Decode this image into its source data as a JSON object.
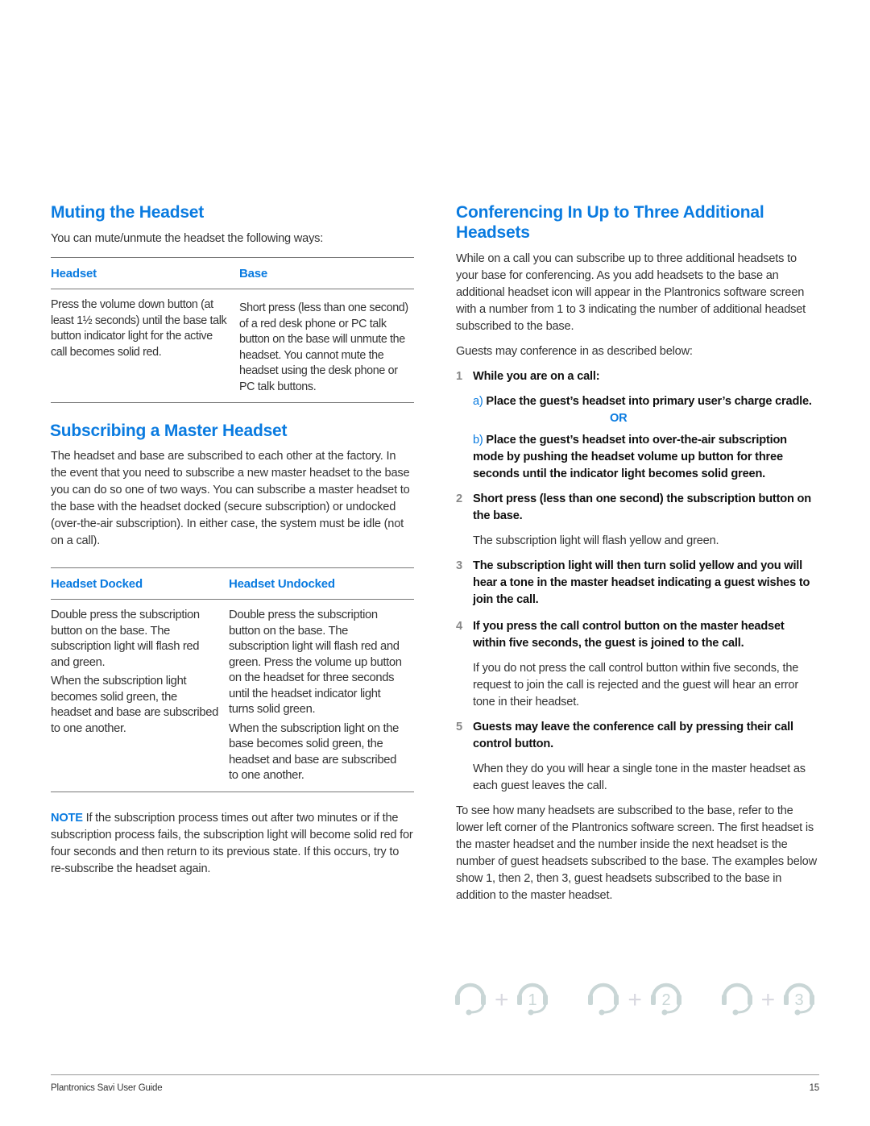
{
  "muting": {
    "title": "Muting the Headset",
    "intro": "You can mute/unmute the headset the following ways:",
    "headers": [
      "Headset",
      "Base"
    ],
    "cells": [
      "Press the volume down button (at least 1½ seconds) until the base talk button indicator light for the active call becomes solid red.",
      "Short press (less than one second) of a red desk phone or PC talk button on the base will unmute the headset. You cannot mute the headset using the desk phone or PC talk buttons."
    ]
  },
  "subscribing": {
    "title": "Subscribing a Master Headset",
    "intro": "The headset and base are subscribed to each other at the factory. In the event that you need to subscribe a new master headset to the base you can do so one of two ways. You can subscribe a master headset to the base with the headset docked (secure subscription) or undocked (over-the-air subscription). In either case, the system must be idle (not on a call).",
    "headers": [
      "Headset Docked",
      "Headset Undocked"
    ],
    "docked": [
      "Double press the subscription button on the base. The subscription light will flash red and green.",
      "When the subscription light becomes solid green, the headset and base are subscribed to one another."
    ],
    "undocked": [
      "Double press the subscription button on the base. The subscription light will flash red and green. Press the volume up button on the headset for three seconds until the headset indicator light turns solid green.",
      "When the subscription light on the base becomes solid green, the headset and base are subscribed to one another."
    ],
    "note_label": "NOTE",
    "note": " If the subscription process times out after two minutes or if the subscription process fails, the subscription light will become solid red for four seconds and then return to its previous state. If this occurs, try to re-subscribe the headset again."
  },
  "conferencing": {
    "title": "Conferencing In Up to Three Additional Headsets",
    "intro": "While on a call you can subscribe up to three additional headsets to your base for conferencing. As you add headsets to the base an additional headset icon will appear in the Plantronics software screen with a number from 1 to 3 indicating the number of additional headset subscribed to the base.",
    "guests": "Guests may conference in as described below:",
    "step1": {
      "num": "1",
      "text": "While you are on a call:",
      "a_label": "a)",
      "a": " Place the guest’s headset into primary user’s charge cradle.",
      "or": "OR",
      "b_label": "b)",
      "b": " Place the guest’s headset into over-the-air subscription mode by pushing the headset volume up button for three seconds until the indicator light becomes solid green."
    },
    "step2": {
      "num": "2",
      "text": "Short press (less than one second) the subscription button on the base.",
      "note": "The subscription light will flash yellow and green."
    },
    "step3": {
      "num": "3",
      "text": "The subscription light will then turn solid yellow and you will hear a tone in the master headset indicating a guest wishes to join the call."
    },
    "step4": {
      "num": "4",
      "text": "If you press the call control button on the master headset within five seconds, the guest is joined to the call.",
      "note": "If you do not press the call control button within five seconds, the request to join the call is rejected and the guest will hear an error tone in their headset."
    },
    "step5": {
      "num": "5",
      "text": "Guests may leave the conference call by pressing their call control button.",
      "note": "When they do you will hear a single tone in the master headset as each guest leaves the call."
    },
    "outro": "To see how many headsets are subscribed to the base, refer to the lower left corner of the Plantronics software screen. The first headset is the master headset and the number inside the next headset is the number of guest headsets subscribed to the base. The examples below show 1, then 2, then 3, guest headsets subscribed to the base in addition to the master headset.",
    "examples": [
      {
        "plus": "+",
        "count": "1"
      },
      {
        "plus": "+",
        "count": "2"
      },
      {
        "plus": "+",
        "count": "3"
      }
    ]
  },
  "footer": {
    "title": "Plantronics Savi User Guide",
    "page": "15"
  },
  "colors": {
    "accent": "#0a7be0",
    "icon": "#c9d6d6"
  }
}
